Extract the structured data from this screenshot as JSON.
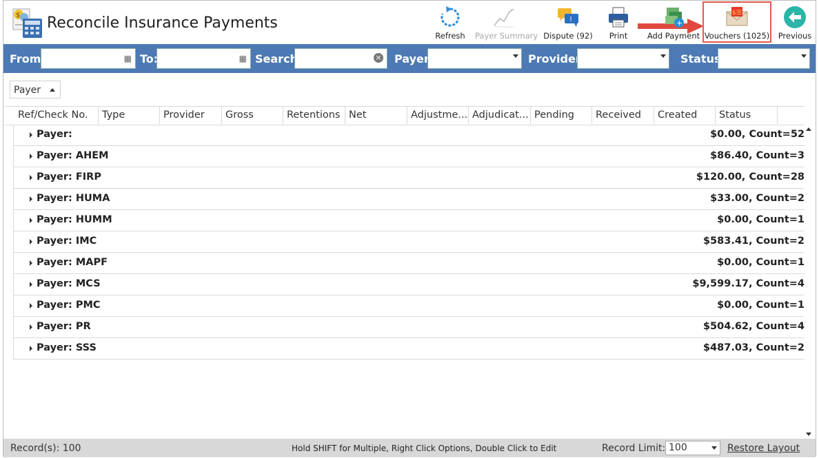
{
  "window": {
    "title": "Reconcile Insurance Payments"
  },
  "toolbar": {
    "refresh": "Refresh",
    "payer_summary": "Payer Summary",
    "dispute": "Dispute (92)",
    "print": "Print",
    "add_payment": "Add Payment",
    "vouchers": "Vouchers (1025)",
    "previous": "Previous"
  },
  "filters": {
    "from_label": "From:",
    "from_value": "",
    "to_label": "To:",
    "to_value": "",
    "search_label": "Search:",
    "search_value": "",
    "payer_label": "Payer:",
    "payer_value": "",
    "provider_label": "Provider:",
    "provider_value": "",
    "status_label": "Status:",
    "status_value": ""
  },
  "grouping": {
    "chip": "Payer"
  },
  "columns": [
    "Ref/Check No.",
    "Type",
    "Provider",
    "Gross",
    "Retentions",
    "Net",
    "Adjustme...",
    "Adjudicat...",
    "Pending",
    "Received",
    "Created",
    "Status"
  ],
  "groups": [
    {
      "label": "Payer:",
      "total": "$0.00,  Count=52"
    },
    {
      "label": "Payer: AHEM",
      "total": "$86.40,  Count=3"
    },
    {
      "label": "Payer: FIRP",
      "total": "$120.00,  Count=28"
    },
    {
      "label": "Payer: HUMA",
      "total": "$33.00,  Count=2"
    },
    {
      "label": "Payer: HUMM",
      "total": "$0.00,  Count=1"
    },
    {
      "label": "Payer: IMC",
      "total": "$583.41,  Count=2"
    },
    {
      "label": "Payer: MAPF",
      "total": "$0.00,  Count=1"
    },
    {
      "label": "Payer: MCS",
      "total": "$9,599.17,  Count=4"
    },
    {
      "label": "Payer: PMC",
      "total": "$0.00,  Count=1"
    },
    {
      "label": "Payer: PR",
      "total": "$504.62,  Count=4"
    },
    {
      "label": "Payer: SSS",
      "total": "$487.03,  Count=2"
    }
  ],
  "statusbar": {
    "records": "Record(s): 100",
    "hint": "Hold SHIFT for Multiple, Right Click Options, Double Click to Edit",
    "limit_label": "Record Limit:",
    "limit_value": "100",
    "restore": "Restore Layout"
  },
  "colors": {
    "filter_bar": "#4d7ab4",
    "highlight": "#e05a4e",
    "statusbar": "#d8d8d8"
  }
}
